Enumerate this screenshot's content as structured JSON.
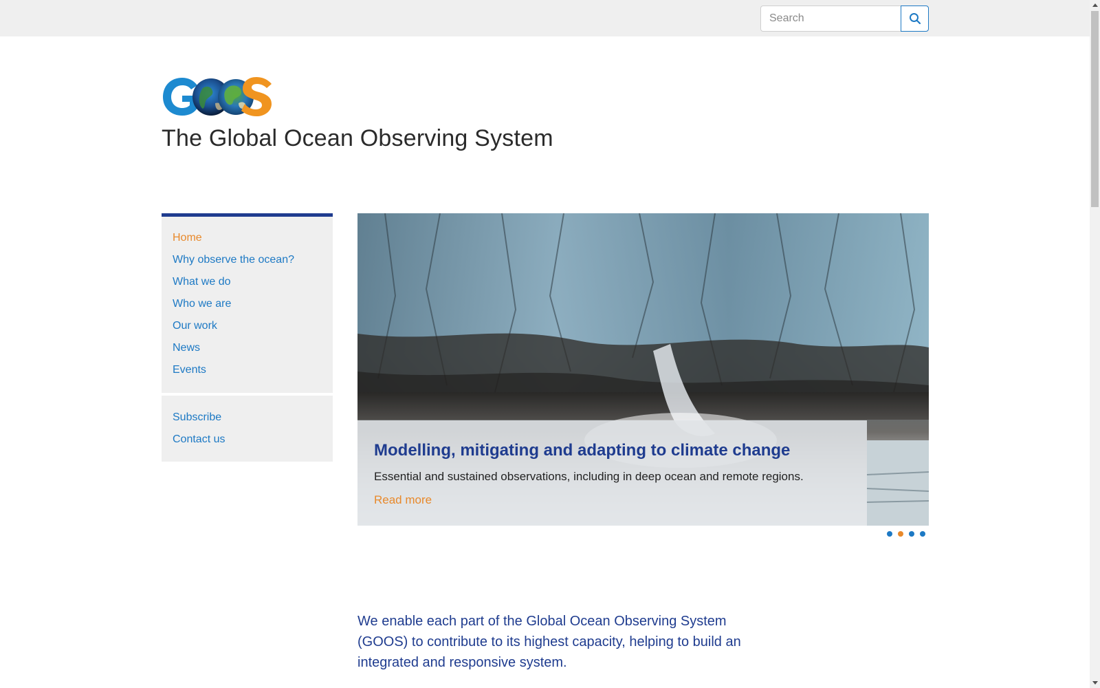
{
  "search": {
    "placeholder": "Search",
    "icon": "search-icon"
  },
  "site": {
    "logo_text": "GOOS",
    "title": "The Global Ocean Observing System"
  },
  "nav": {
    "primary": [
      {
        "label": "Home",
        "active": true
      },
      {
        "label": "Why observe the ocean?",
        "active": false
      },
      {
        "label": "What we do",
        "active": false
      },
      {
        "label": "Who we are",
        "active": false
      },
      {
        "label": "Our work",
        "active": false
      },
      {
        "label": "News",
        "active": false
      },
      {
        "label": "Events",
        "active": false
      }
    ],
    "secondary": [
      {
        "label": "Subscribe"
      },
      {
        "label": "Contact us"
      }
    ]
  },
  "carousel": {
    "slide_title": "Modelling, mitigating and adapting to climate change",
    "slide_text": "Essential and sustained observations, including in deep ocean and remote regions.",
    "read_more": "Read more",
    "slide_count": 4,
    "active_index": 1
  },
  "intro": {
    "text": "We enable each part of the Global Ocean Observing System (GOOS) to contribute to its highest capacity, helping to build an integrated and responsive system."
  },
  "colors": {
    "brand_blue": "#1f3c8f",
    "link_blue": "#1d79c4",
    "accent_orange": "#e8892b",
    "panel_grey": "#efefef"
  }
}
